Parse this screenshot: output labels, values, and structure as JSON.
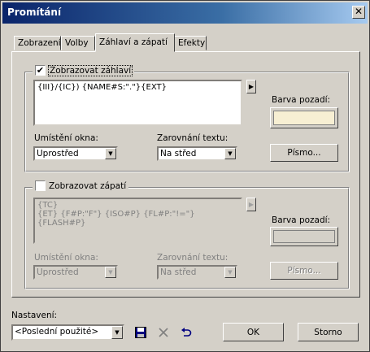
{
  "window": {
    "title": "Promítání"
  },
  "tabs": [
    {
      "label": "Zobrazení"
    },
    {
      "label": "Volby"
    },
    {
      "label": "Záhlaví a zápatí"
    },
    {
      "label": "Efekty"
    }
  ],
  "header": {
    "checkbox_label": "Zobrazovat záhlaví",
    "checked": true,
    "text": "{III}/{IC}) {NAME#S:\".\"}{EXT}",
    "bg_label": "Barva pozadí:",
    "bg_color": "#f7efd3",
    "position_label": "Umístění okna:",
    "position_value": "Uprostřed",
    "align_label": "Zarovnání textu:",
    "align_value": "Na střed",
    "font_button": "Písmo..."
  },
  "footer": {
    "checkbox_label": "Zobrazovat zápatí",
    "checked": false,
    "text_line1": "{TC}",
    "text_line2": "{ET} {F#P:\"F\"} {ISO#P} {FL#P:\"!=\"} {FLASH#P}",
    "bg_label": "Barva pozadí:",
    "position_label": "Umístění okna:",
    "position_value": "Uprostřed",
    "align_label": "Zarovnání textu:",
    "align_value": "Na střed",
    "font_button": "Písmo..."
  },
  "settings": {
    "label": "Nastavení:",
    "value": "<Poslední použité>"
  },
  "buttons": {
    "ok": "OK",
    "cancel": "Storno"
  }
}
